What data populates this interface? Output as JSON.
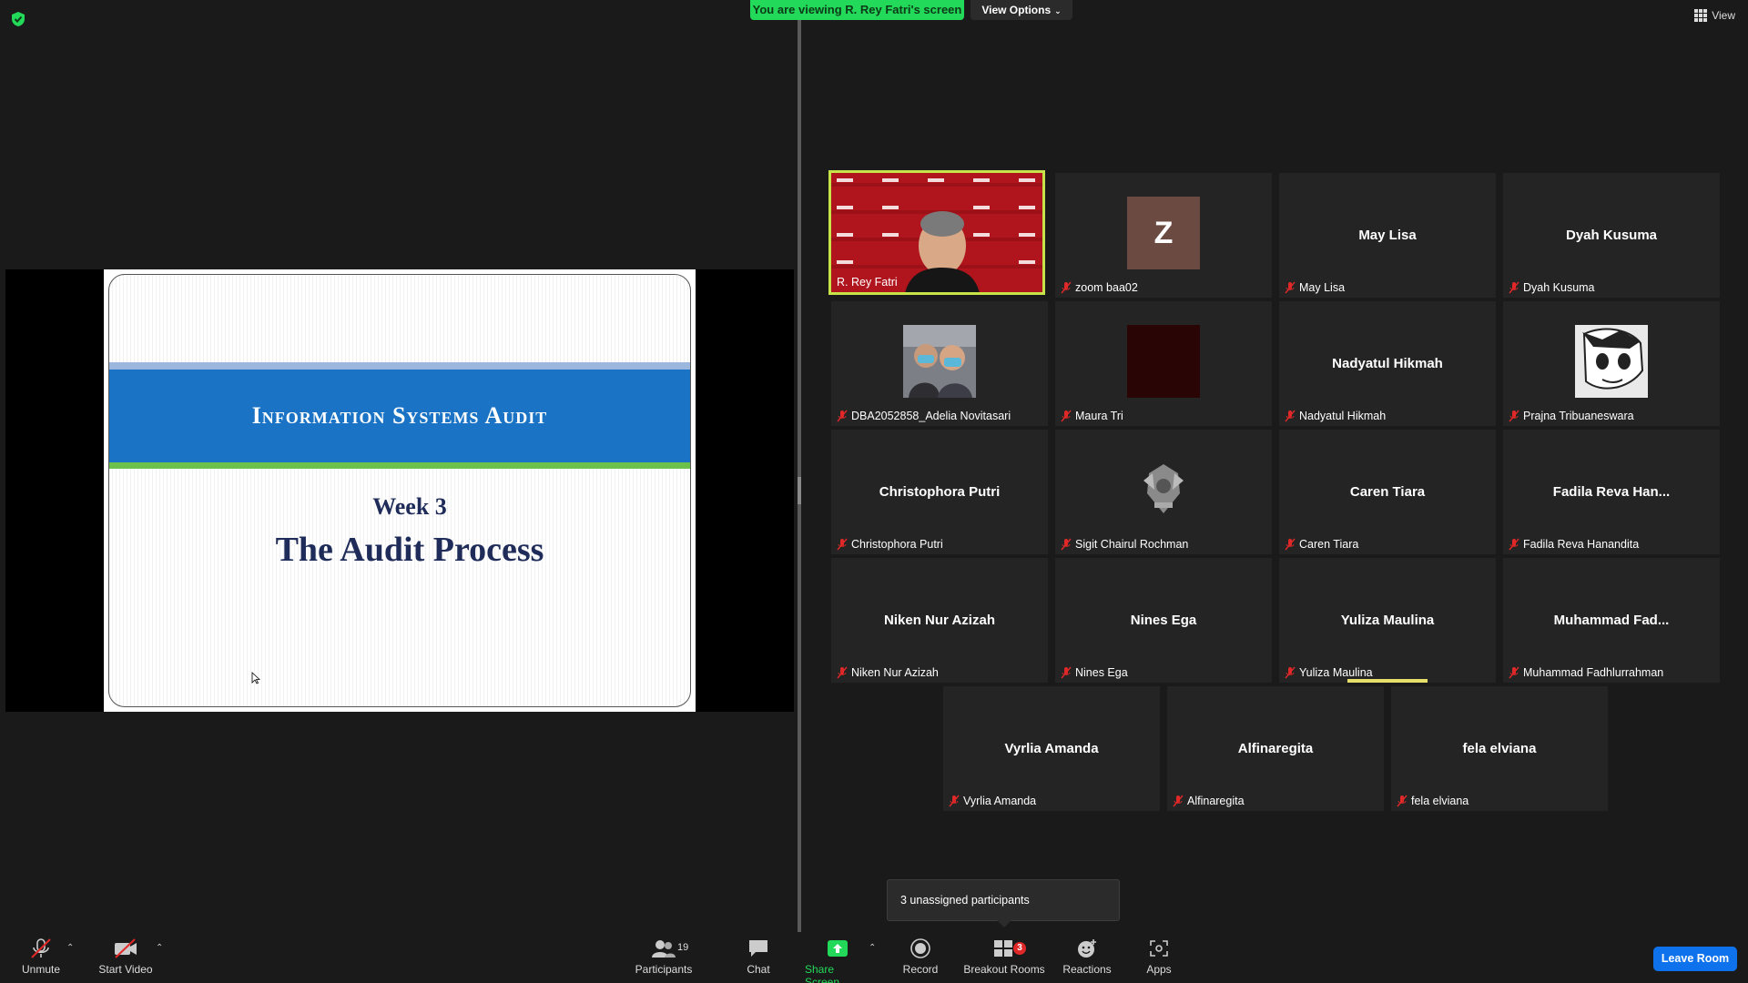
{
  "top": {
    "banner": "You are viewing R. Rey Fatri's screen",
    "view_options": "View Options",
    "view": "View"
  },
  "slide": {
    "title": "Information Systems Audit",
    "week": "Week 3",
    "subtitle": "The Audit Process"
  },
  "gallery": {
    "tiles": [
      {
        "label": "R. Rey Fatri",
        "center": ""
      },
      {
        "label": "zoom baa02",
        "center": "",
        "avatar_letter": "Z"
      },
      {
        "label": "May Lisa",
        "center": "May Lisa"
      },
      {
        "label": "Dyah Kusuma",
        "center": "Dyah Kusuma"
      },
      {
        "label": "DBA2052858_Adelia Novitasari",
        "center": ""
      },
      {
        "label": "Maura Tri",
        "center": ""
      },
      {
        "label": "Nadyatul Hikmah",
        "center": "Nadyatul Hikmah"
      },
      {
        "label": "Prajna Tribuaneswara",
        "center": ""
      },
      {
        "label": "Christophora Putri",
        "center": "Christophora Putri"
      },
      {
        "label": "Sigit Chairul Rochman",
        "center": ""
      },
      {
        "label": "Caren Tiara",
        "center": "Caren Tiara"
      },
      {
        "label": "Fadila Reva Hanandita",
        "center": "Fadila Reva Han..."
      },
      {
        "label": "Niken Nur Azizah",
        "center": "Niken Nur Azizah"
      },
      {
        "label": "Nines Ega",
        "center": "Nines Ega"
      },
      {
        "label": "Yuliza Maulina",
        "center": "Yuliza Maulina"
      },
      {
        "label": "Muhammad Fadhlurrahman",
        "center": "Muhammad  Fad..."
      },
      {
        "label": "Vyrlia Amanda",
        "center": "Vyrlia Amanda"
      },
      {
        "label": "Alfinaregita",
        "center": "Alfinaregita"
      },
      {
        "label": "fela elviana",
        "center": "fela elviana"
      }
    ]
  },
  "tooltip": {
    "unassigned": "3 unassigned participants"
  },
  "toolbar": {
    "unmute": "Unmute",
    "start_video": "Start Video",
    "participants": "Participants",
    "participants_count": "19",
    "chat": "Chat",
    "share_screen": "Share Screen",
    "record": "Record",
    "breakout_rooms": "Breakout Rooms",
    "breakout_badge": "3",
    "reactions": "Reactions",
    "apps": "Apps",
    "leave": "Leave Room"
  },
  "colors": {
    "banner_green": "#23d959",
    "active_border": "#c6e34a",
    "leave_blue": "#0e72ed",
    "slide_band": "#1a73c4"
  }
}
